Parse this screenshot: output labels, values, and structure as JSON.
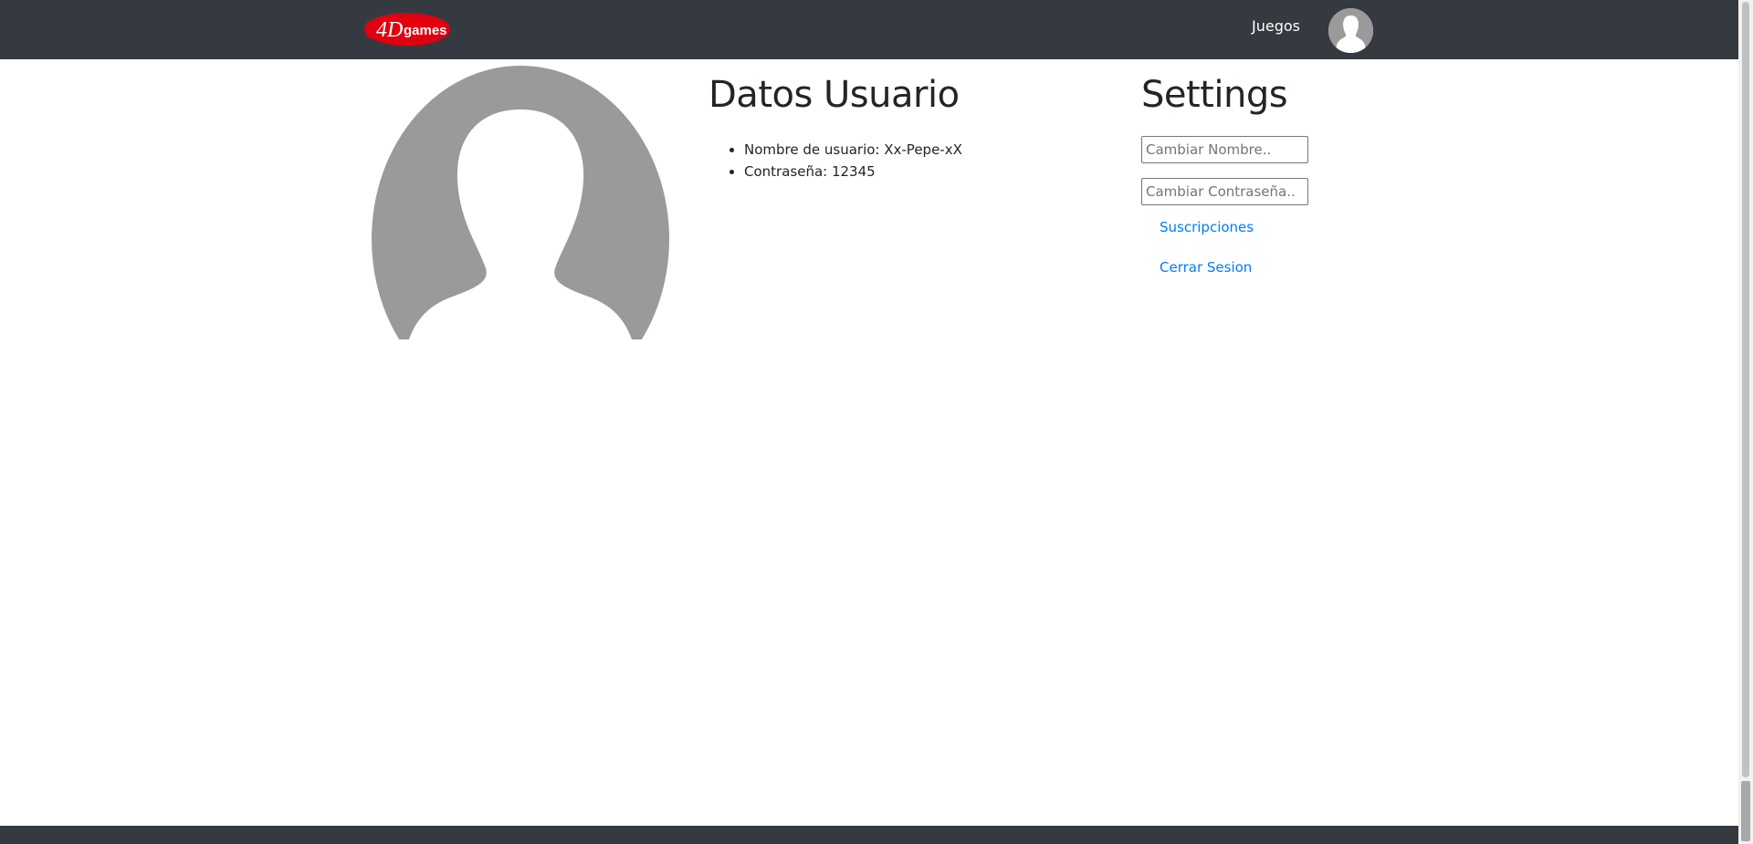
{
  "navbar": {
    "brand_logo_text": "4Dgames",
    "links": [
      {
        "label": "Juegos"
      }
    ],
    "avatar_icon": "user-avatar-icon"
  },
  "profile": {
    "avatar_icon": "user-silhouette-icon"
  },
  "datos_usuario": {
    "title": "Datos Usuario",
    "items": [
      {
        "label": "Nombre de usuario: Xx-Pepe-xX"
      },
      {
        "label": "Contraseña: 12345"
      }
    ]
  },
  "settings": {
    "title": "Settings",
    "change_name_placeholder": "Cambiar Nombre..",
    "change_password_placeholder": "Cambiar Contraseña..",
    "links": [
      {
        "label": "Suscripciones"
      },
      {
        "label": "Cerrar Sesion"
      }
    ]
  },
  "colors": {
    "navbar_bg": "#343a40",
    "link": "#007bff",
    "logo_red": "#e0000f",
    "avatar_gray": "#9a9a9a"
  }
}
